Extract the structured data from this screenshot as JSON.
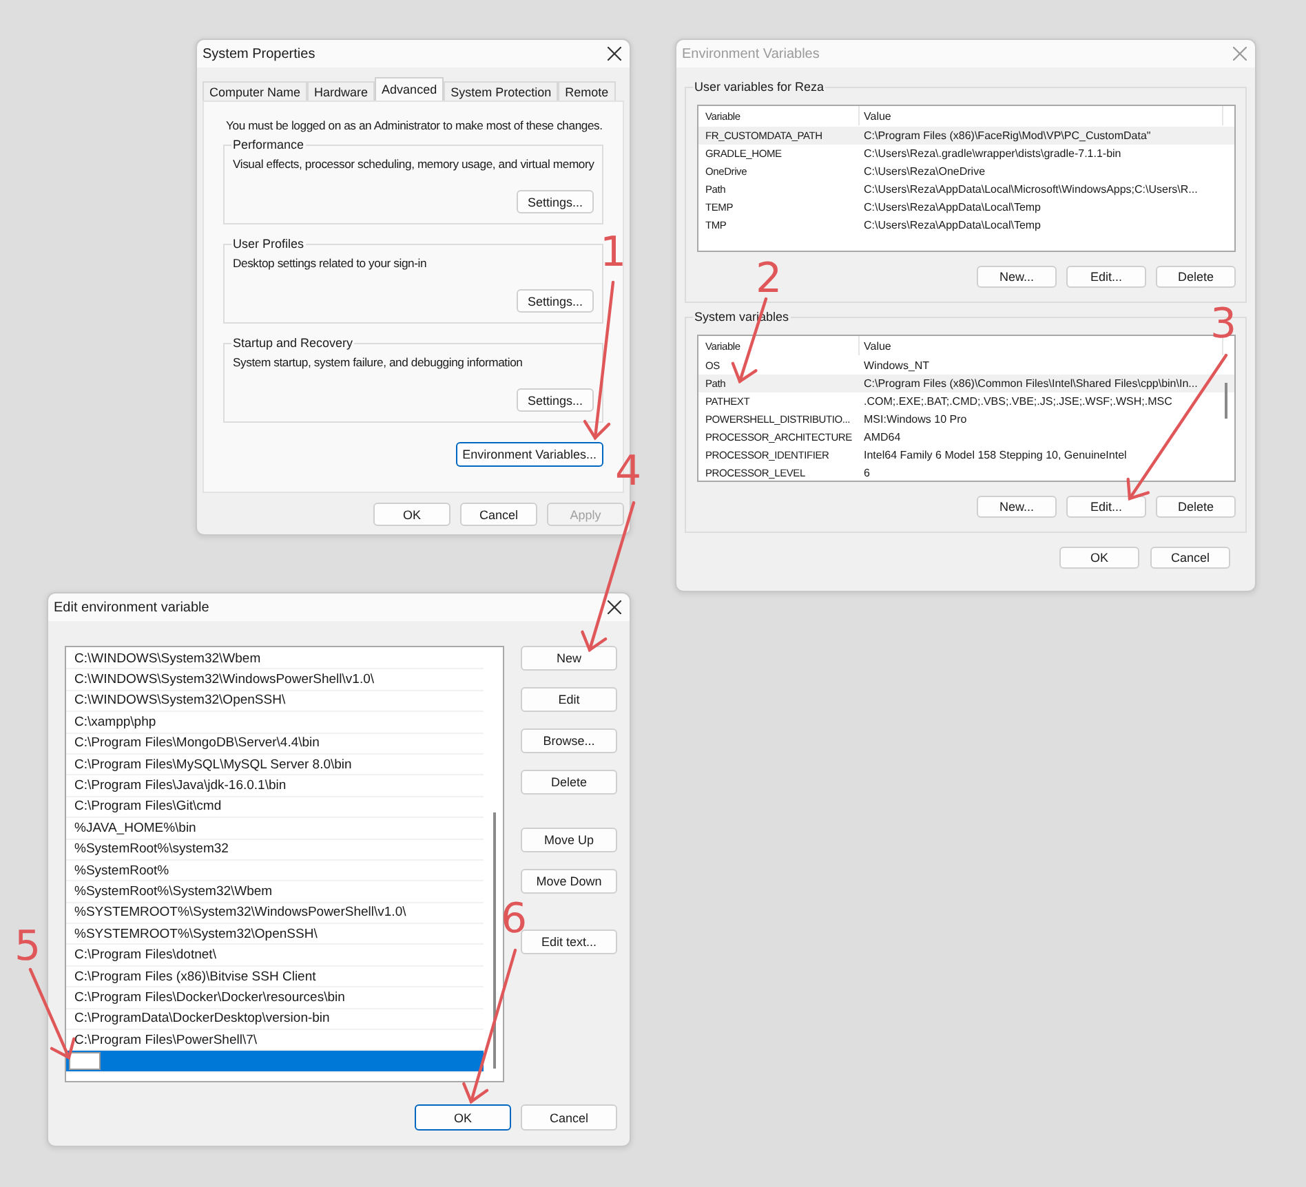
{
  "system_properties": {
    "title": "System Properties",
    "active": true,
    "tabs": [
      {
        "label": "Computer Name",
        "selected": false
      },
      {
        "label": "Hardware",
        "selected": false
      },
      {
        "label": "Advanced",
        "selected": true
      },
      {
        "label": "System Protection",
        "selected": false
      },
      {
        "label": "Remote",
        "selected": false
      }
    ],
    "notice": "You must be logged on as an Administrator to make most of these changes.",
    "groups": [
      {
        "title": "Performance",
        "description": "Visual effects, processor scheduling, memory usage, and virtual memory",
        "button": "Settings..."
      },
      {
        "title": "User Profiles",
        "description": "Desktop settings related to your sign-in",
        "button": "Settings..."
      },
      {
        "title": "Startup and Recovery",
        "description": "System startup, system failure, and debugging information",
        "button": "Settings..."
      }
    ],
    "env_button": {
      "label": "Environment Variables...",
      "focused": true
    },
    "buttons": [
      {
        "label": "OK",
        "disabled": false
      },
      {
        "label": "Cancel",
        "disabled": false
      },
      {
        "label": "Apply",
        "disabled": true
      }
    ]
  },
  "environment_variables": {
    "title": "Environment Variables",
    "active": false,
    "sections": [
      {
        "title": "User variables for Reza",
        "columns": [
          "Variable",
          "Value"
        ],
        "scrollbar": false,
        "buttons": [
          "New...",
          "Edit...",
          "Delete"
        ],
        "rows": [
          {
            "variable": "FR_CUSTOMDATA_PATH",
            "value": "C:\\Program Files (x86)\\FaceRig\\Mod\\VP\\PC_CustomData\"",
            "selected": true
          },
          {
            "variable": "GRADLE_HOME",
            "value": "C:\\Users\\Reza\\.gradle\\wrapper\\dists\\gradle-7.1.1-bin",
            "selected": false
          },
          {
            "variable": "OneDrive",
            "value": "C:\\Users\\Reza\\OneDrive",
            "selected": false
          },
          {
            "variable": "Path",
            "value": "C:\\Users\\Reza\\AppData\\Local\\Microsoft\\WindowsApps;C:\\Users\\R...",
            "selected": false
          },
          {
            "variable": "TEMP",
            "value": "C:\\Users\\Reza\\AppData\\Local\\Temp",
            "selected": false
          },
          {
            "variable": "TMP",
            "value": "C:\\Users\\Reza\\AppData\\Local\\Temp",
            "selected": false
          }
        ]
      },
      {
        "title": "System variables",
        "columns": [
          "Variable",
          "Value"
        ],
        "scrollbar": true,
        "buttons": [
          "New...",
          "Edit...",
          "Delete"
        ],
        "rows": [
          {
            "variable": "OS",
            "value": "Windows_NT",
            "selected": false
          },
          {
            "variable": "Path",
            "value": "C:\\Program Files (x86)\\Common Files\\Intel\\Shared Files\\cpp\\bin\\In...",
            "selected": true
          },
          {
            "variable": "PATHEXT",
            "value": ".COM;.EXE;.BAT;.CMD;.VBS;.VBE;.JS;.JSE;.WSF;.WSH;.MSC",
            "selected": false
          },
          {
            "variable": "POWERSHELL_DISTRIBUTIO...",
            "value": "MSI:Windows 10 Pro",
            "selected": false
          },
          {
            "variable": "PROCESSOR_ARCHITECTURE",
            "value": "AMD64",
            "selected": false
          },
          {
            "variable": "PROCESSOR_IDENTIFIER",
            "value": "Intel64 Family 6 Model 158 Stepping 10, GenuineIntel",
            "selected": false
          },
          {
            "variable": "PROCESSOR_LEVEL",
            "value": "6",
            "selected": false
          }
        ]
      }
    ],
    "buttons": [
      "OK",
      "Cancel"
    ]
  },
  "edit_variable": {
    "title": "Edit environment variable",
    "active": true,
    "entries": [
      {
        "kind": "text",
        "text": "C:\\WINDOWS\\System32\\Wbem",
        "selected": false
      },
      {
        "kind": "text",
        "text": "C:\\WINDOWS\\System32\\WindowsPowerShell\\v1.0\\",
        "selected": false
      },
      {
        "kind": "text",
        "text": "C:\\WINDOWS\\System32\\OpenSSH\\",
        "selected": false
      },
      {
        "kind": "text",
        "text": "C:\\xampp\\php",
        "selected": false
      },
      {
        "kind": "text",
        "text": "C:\\Program Files\\MongoDB\\Server\\4.4\\bin",
        "selected": false
      },
      {
        "kind": "text",
        "text": "C:\\Program Files\\MySQL\\MySQL Server 8.0\\bin",
        "selected": false
      },
      {
        "kind": "text",
        "text": "C:\\Program Files\\Java\\jdk-16.0.1\\bin",
        "selected": false
      },
      {
        "kind": "text",
        "text": "C:\\Program Files\\Git\\cmd",
        "selected": false
      },
      {
        "kind": "text",
        "text": "%JAVA_HOME%\\bin",
        "selected": false
      },
      {
        "kind": "text",
        "text": "%SystemRoot%\\system32",
        "selected": false
      },
      {
        "kind": "text",
        "text": "%SystemRoot%",
        "selected": false
      },
      {
        "kind": "text",
        "text": "%SystemRoot%\\System32\\Wbem",
        "selected": false
      },
      {
        "kind": "text",
        "text": "%SYSTEMROOT%\\System32\\WindowsPowerShell\\v1.0\\",
        "selected": false
      },
      {
        "kind": "text",
        "text": "%SYSTEMROOT%\\System32\\OpenSSH\\",
        "selected": false
      },
      {
        "kind": "text",
        "text": "C:\\Program Files\\dotnet\\",
        "selected": false
      },
      {
        "kind": "text",
        "text": "C:\\Program Files (x86)\\Bitvise SSH Client",
        "selected": false
      },
      {
        "kind": "text",
        "text": "C:\\Program Files\\Docker\\Docker\\resources\\bin",
        "selected": false
      },
      {
        "kind": "text",
        "text": "C:\\ProgramData\\DockerDesktop\\version-bin",
        "selected": false
      },
      {
        "kind": "text",
        "text": "C:\\Program Files\\PowerShell\\7\\",
        "selected": false
      },
      {
        "kind": "input",
        "selected": true
      }
    ],
    "side_buttons": [
      [
        "New",
        "Edit",
        "Browse...",
        "Delete"
      ],
      [
        "Move Up",
        "Move Down"
      ],
      [
        "Edit text..."
      ]
    ],
    "buttons": [
      {
        "label": "OK",
        "default": true
      },
      {
        "label": "Cancel",
        "default": false
      }
    ]
  },
  "annotations": [
    {
      "label": "1"
    },
    {
      "label": "2"
    },
    {
      "label": "3"
    },
    {
      "label": "4"
    },
    {
      "label": "5"
    },
    {
      "label": "6"
    }
  ]
}
